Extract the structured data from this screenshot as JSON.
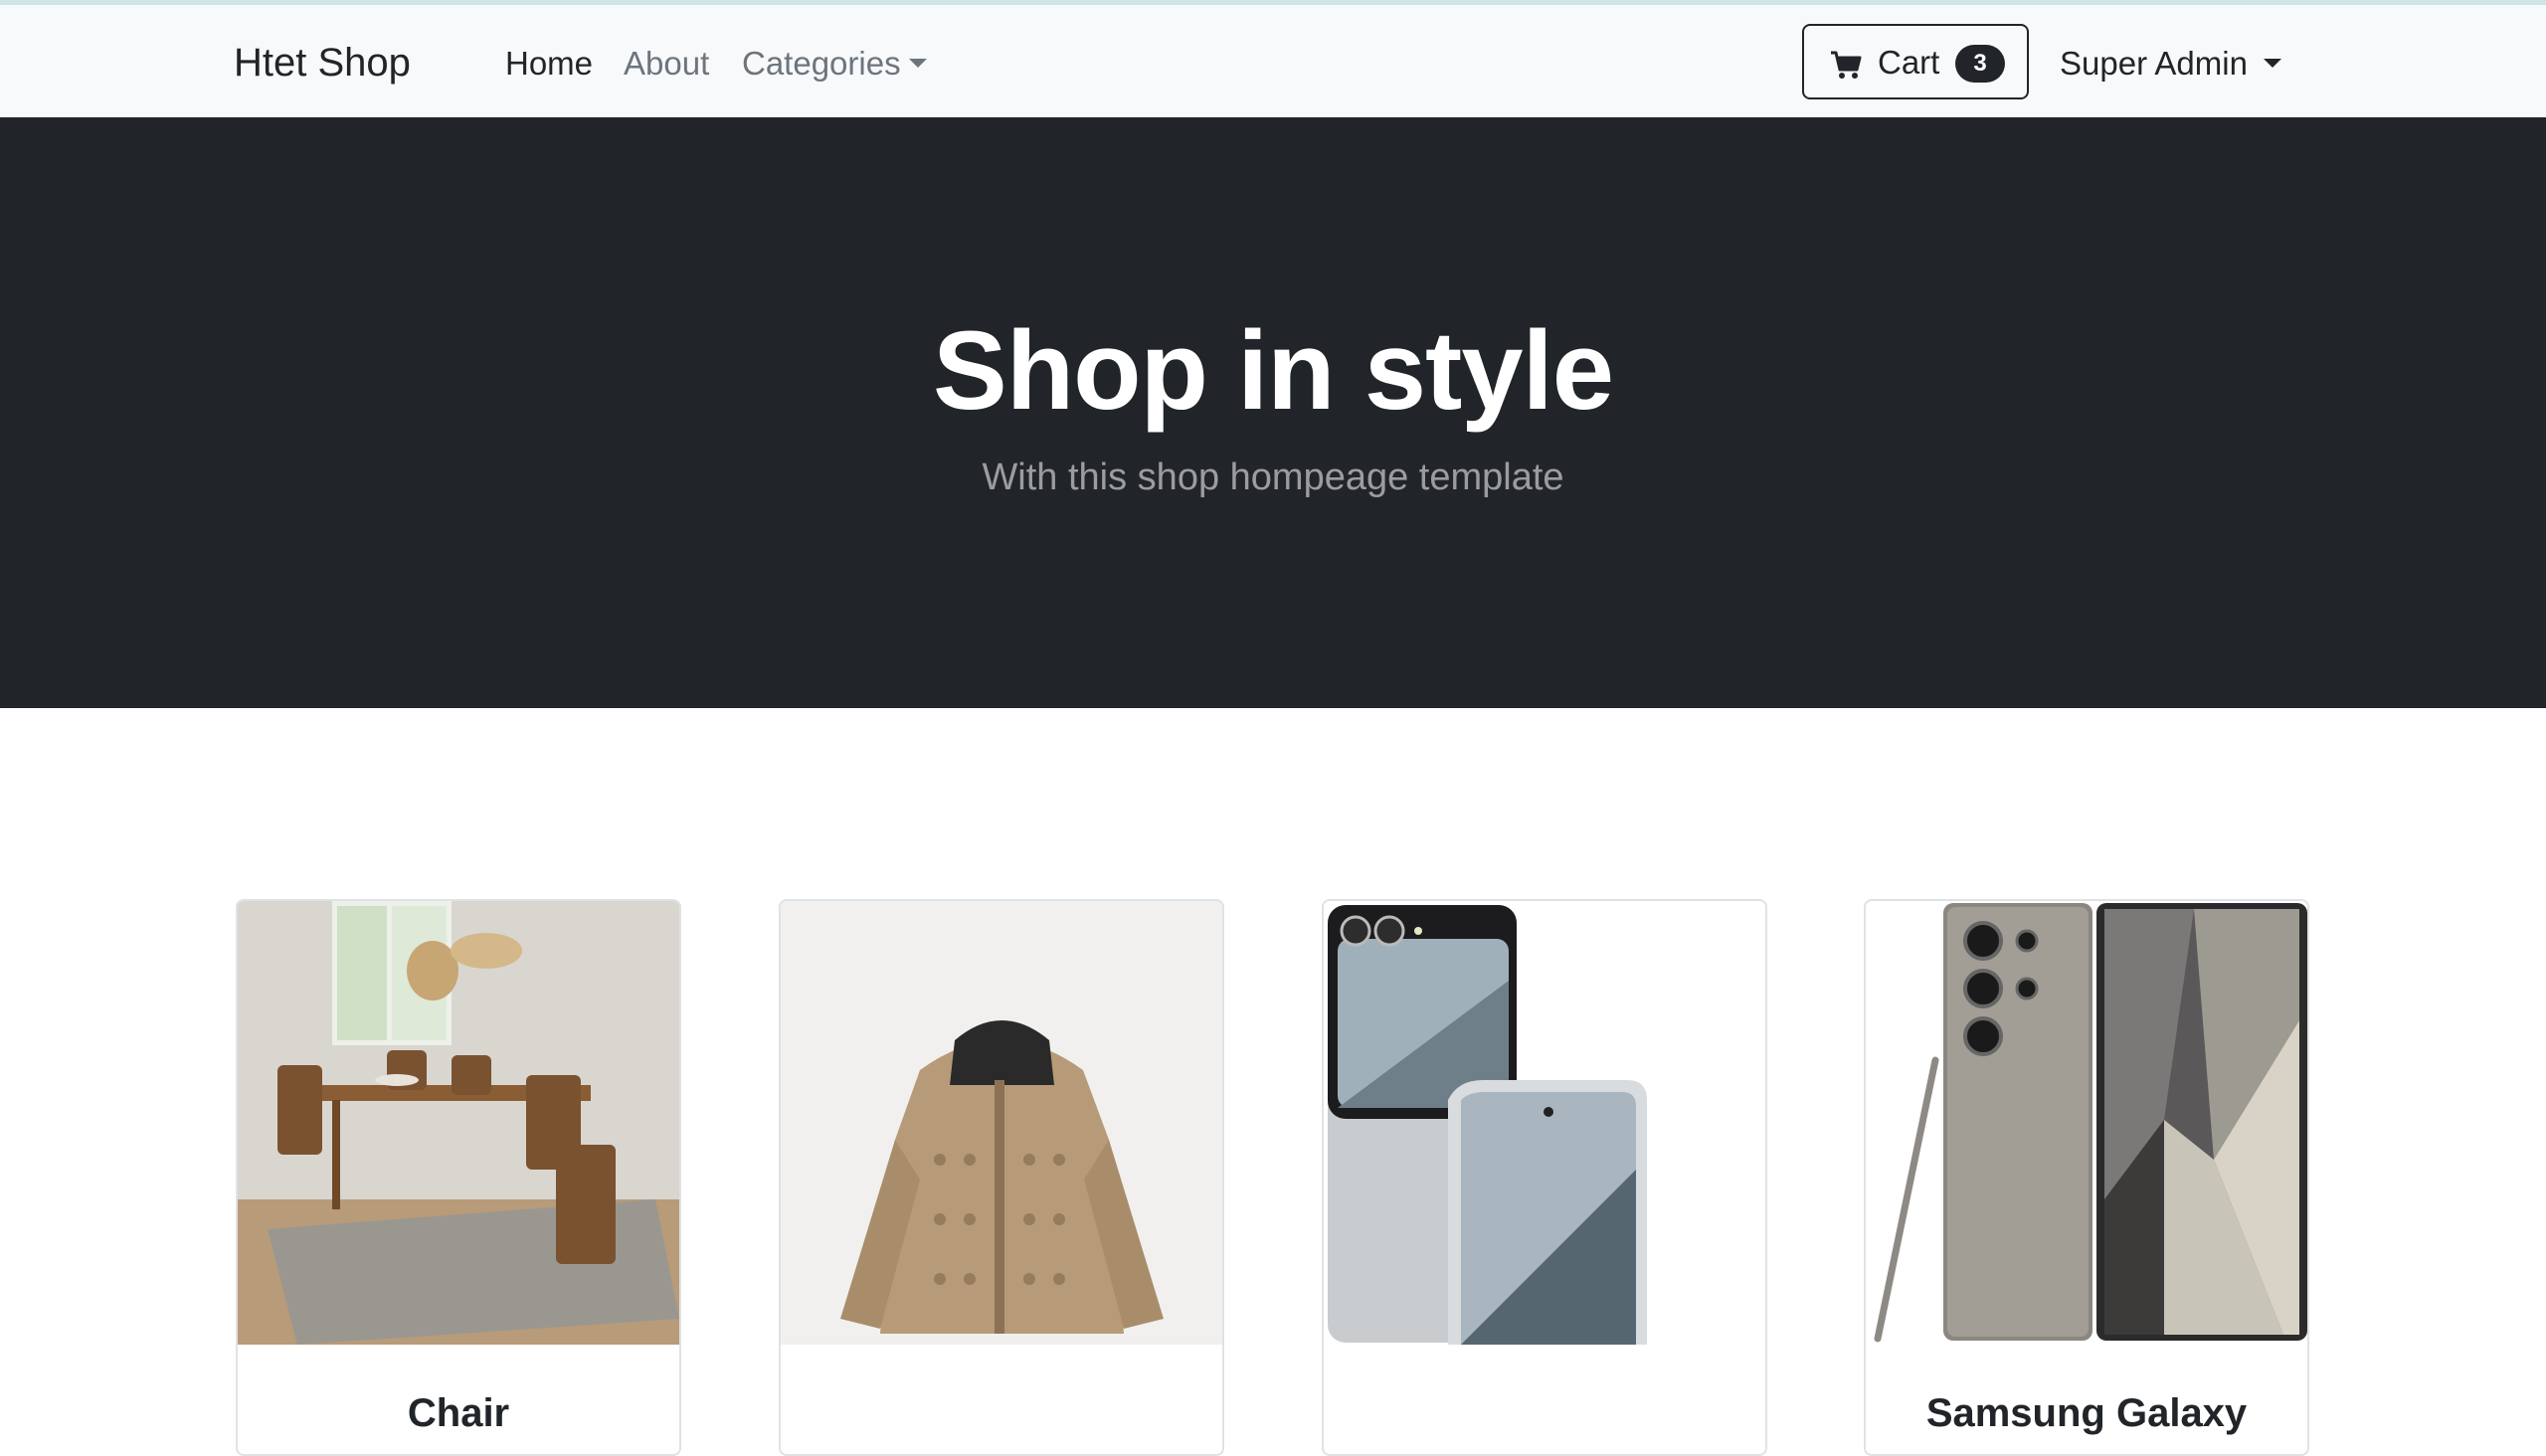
{
  "navbar": {
    "brand": "Htet Shop",
    "links": [
      {
        "label": "Home"
      },
      {
        "label": "About"
      },
      {
        "label": "Categories"
      }
    ],
    "cart": {
      "label": "Cart",
      "count": "3"
    },
    "user": {
      "label": "Super Admin"
    }
  },
  "hero": {
    "title": "Shop in style",
    "subtitle": "With this shop hompeage template"
  },
  "products": [
    {
      "title": "Chair"
    },
    {
      "title": ""
    },
    {
      "title": ""
    },
    {
      "title": "Samsung Galaxy"
    }
  ],
  "colors": {
    "navbar_bg": "#f8f9fa",
    "hero_bg": "#212529",
    "text": "#212529",
    "muted": "#6c757d"
  }
}
